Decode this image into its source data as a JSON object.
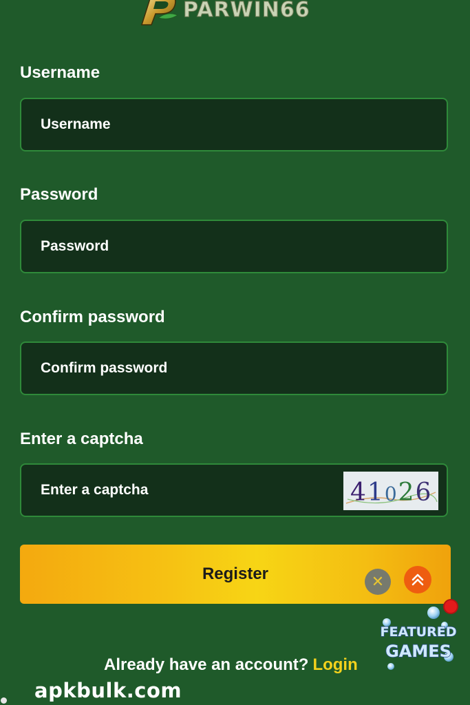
{
  "brand": {
    "logo_text": "PARWIN66"
  },
  "form": {
    "username": {
      "label": "Username",
      "placeholder": "Username"
    },
    "password": {
      "label": "Password",
      "placeholder": "Password"
    },
    "confirm_password": {
      "label": "Confirm password",
      "placeholder": "Confirm password"
    },
    "captcha": {
      "label": "Enter a captcha",
      "placeholder": "Enter a captcha",
      "code": "41026"
    },
    "register_label": "Register"
  },
  "footer": {
    "prompt": "Already have an account?",
    "login_label": "Login"
  },
  "floating": {
    "close_symbol": "✕",
    "featured_line1": "FEATURED",
    "featured_line2": "GAMES"
  },
  "watermark": "apkbulk.com",
  "colors": {
    "background": "#1f5a2a",
    "field_bg": "#13301a",
    "field_border": "#2f8a3a",
    "accent_yellow": "#f3d21c",
    "button_gradient_start": "#f4a90f",
    "scroll_top": "#ee5d10"
  },
  "icons": {
    "logo": "parwin-emblem-icon",
    "close": "close-icon",
    "scroll_top": "double-chevron-up-icon"
  }
}
